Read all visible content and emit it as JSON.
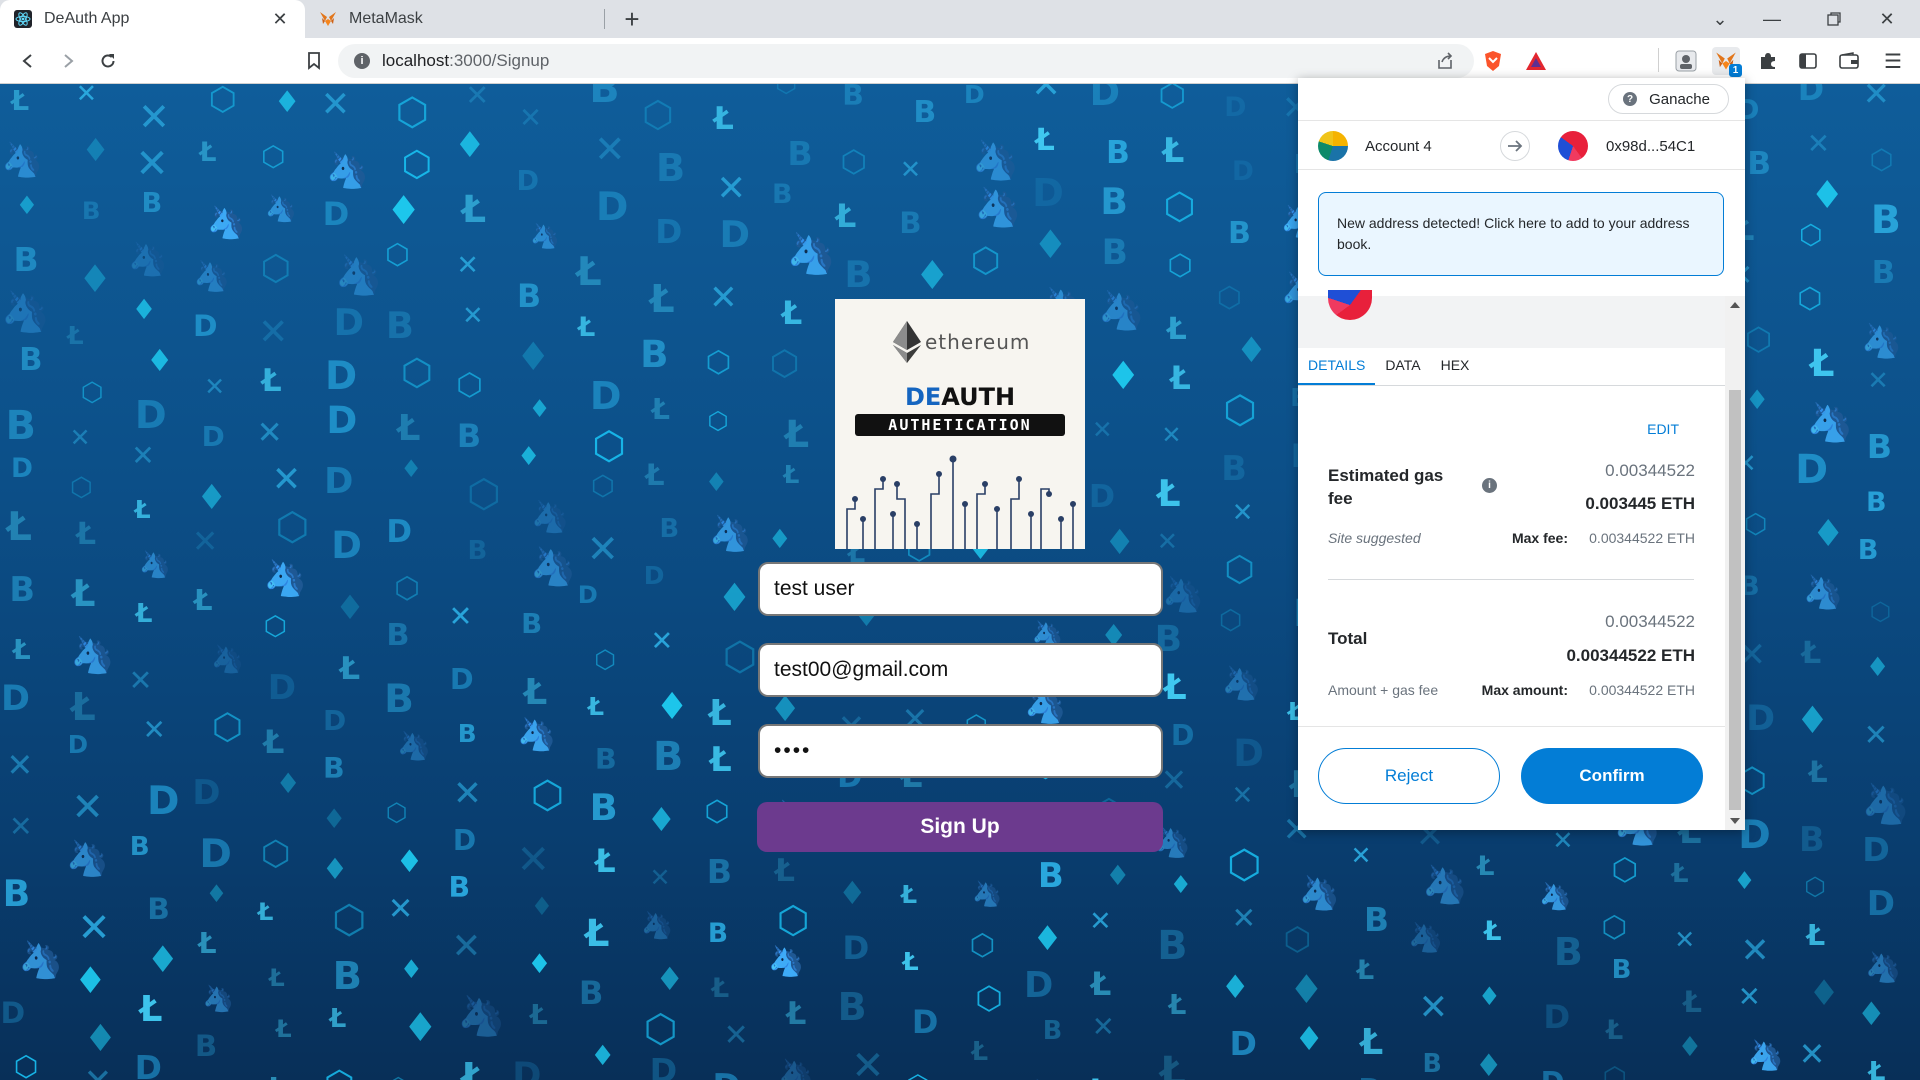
{
  "browser": {
    "tabs": [
      {
        "title": "DeAuth App",
        "active": true
      },
      {
        "title": "MetaMask",
        "active": false
      }
    ],
    "url_host": "localhost",
    "url_path": ":3000/Signup"
  },
  "page": {
    "logo": {
      "brand": "ethereum",
      "title_accent": "DE",
      "title_rest": "AUTH",
      "subtitle": "AUTHETICATION"
    },
    "form": {
      "username": "test user",
      "email": "test00@gmail.com",
      "password_mask": "••••",
      "submit_label": "Sign Up"
    },
    "bg_text": {
      "lite": "Ł",
      "btc": "B",
      "dash": "D",
      "xrp": "✕",
      "eth": "♦",
      "hex": "⬡",
      "unicorn": "🦄"
    }
  },
  "metamask": {
    "network": "Ganache",
    "from_account": "Account 4",
    "to_address": "0x98d...54C1",
    "notice": "New address detected! Click here to add to your address book.",
    "tabs": [
      "DETAILS",
      "DATA",
      "HEX"
    ],
    "edit_label": "EDIT",
    "gas": {
      "label": "Estimated gas fee",
      "value_top": "0.00344522",
      "value_main": "0.003445 ETH",
      "site_note": "Site suggested",
      "max_label": "Max fee:",
      "max_value": "0.00344522 ETH"
    },
    "total": {
      "label": "Total",
      "value_top": "0.00344522",
      "value_main": "0.00344522 ETH",
      "sub_note": "Amount + gas fee",
      "max_label": "Max amount:",
      "max_value": "0.00344522 ETH"
    },
    "reject_label": "Reject",
    "confirm_label": "Confirm",
    "badge": "1",
    "colors": {
      "primary": "#037dd6"
    }
  }
}
